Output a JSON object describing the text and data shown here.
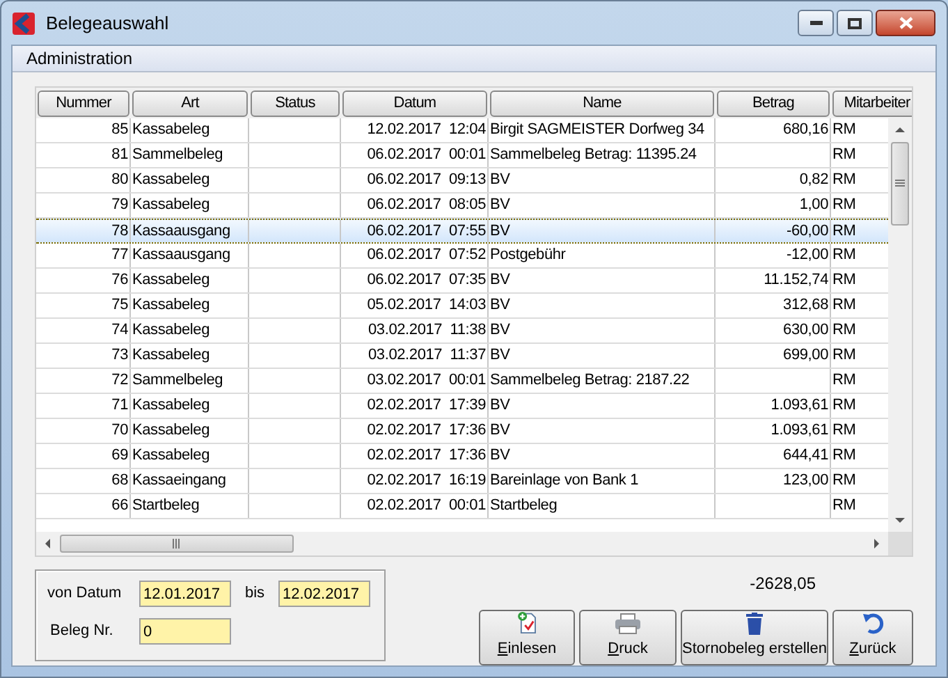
{
  "window": {
    "title": "Belegeauswahl"
  },
  "menu": [
    "Administration"
  ],
  "table": {
    "columns": [
      "Nummer",
      "Art",
      "Status",
      "Datum",
      "Name",
      "Betrag",
      "Mitarbeiter"
    ],
    "rows": [
      {
        "nummer": "85",
        "art": "Kassabeleg",
        "datum": "12.02.2017  12:04",
        "name": "Birgit SAGMEISTER  Dorfweg 34",
        "betrag": "680,16",
        "mitarbeiter": "RM",
        "selected": false
      },
      {
        "nummer": "81",
        "art": "Sammelbeleg",
        "datum": "06.02.2017  00:01",
        "name": "Sammelbeleg Betrag: 11395.24",
        "mitarbeiter": "RM",
        "selected": false
      },
      {
        "nummer": "80",
        "art": "Kassabeleg",
        "datum": "06.02.2017  09:13",
        "name": "BV",
        "betrag": "0,82",
        "mitarbeiter": "RM",
        "selected": false
      },
      {
        "nummer": "79",
        "art": "Kassabeleg",
        "datum": "06.02.2017  08:05",
        "name": "BV",
        "betrag": "1,00",
        "mitarbeiter": "RM",
        "selected": false
      },
      {
        "nummer": "78",
        "art": "Kassaausgang",
        "datum": "06.02.2017  07:55",
        "name": "BV",
        "betrag": "-60,00",
        "mitarbeiter": "RM",
        "selected": true
      },
      {
        "nummer": "77",
        "art": "Kassaausgang",
        "datum": "06.02.2017  07:52",
        "name": "Postgebühr",
        "betrag": "-12,00",
        "mitarbeiter": "RM",
        "selected": false
      },
      {
        "nummer": "76",
        "art": "Kassabeleg",
        "datum": "06.02.2017  07:35",
        "name": "BV",
        "betrag": "11.152,74",
        "mitarbeiter": "RM",
        "selected": false
      },
      {
        "nummer": "75",
        "art": "Kassabeleg",
        "datum": "05.02.2017  14:03",
        "name": "BV",
        "betrag": "312,68",
        "mitarbeiter": "RM",
        "selected": false
      },
      {
        "nummer": "74",
        "art": "Kassabeleg",
        "datum": "03.02.2017  11:38",
        "name": "BV",
        "betrag": "630,00",
        "mitarbeiter": "RM",
        "selected": false
      },
      {
        "nummer": "73",
        "art": "Kassabeleg",
        "datum": "03.02.2017  11:37",
        "name": "BV",
        "betrag": "699,00",
        "mitarbeiter": "RM",
        "selected": false
      },
      {
        "nummer": "72",
        "art": "Sammelbeleg",
        "datum": "03.02.2017  00:01",
        "name": "Sammelbeleg Betrag: 2187.22",
        "mitarbeiter": "RM",
        "selected": false
      },
      {
        "nummer": "71",
        "art": "Kassabeleg",
        "datum": "02.02.2017  17:39",
        "name": "BV",
        "betrag": "1.093,61",
        "mitarbeiter": "RM",
        "selected": false
      },
      {
        "nummer": "70",
        "art": "Kassabeleg",
        "datum": "02.02.2017  17:36",
        "name": "BV",
        "betrag": "1.093,61",
        "mitarbeiter": "RM",
        "selected": false
      },
      {
        "nummer": "69",
        "art": "Kassabeleg",
        "datum": "02.02.2017  17:36",
        "name": "BV",
        "betrag": "644,41",
        "mitarbeiter": "RM",
        "selected": false
      },
      {
        "nummer": "68",
        "art": "Kassaeingang",
        "datum": "02.02.2017  16:19",
        "name": "Bareinlage von Bank 1",
        "betrag": "123,00",
        "mitarbeiter": "RM",
        "selected": false
      },
      {
        "nummer": "66",
        "art": "Startbeleg",
        "datum": "02.02.2017  00:01",
        "name": "Startbeleg",
        "mitarbeiter": "RM",
        "selected": false
      }
    ]
  },
  "filter": {
    "von_label": "von Datum",
    "von": "12.01.2017",
    "bis_label": "bis",
    "bis": "12.02.2017",
    "beleg_label": "Beleg Nr.",
    "beleg": "0"
  },
  "total": "-2628,05",
  "buttons": [
    {
      "label": "Einlesen",
      "kind": "import",
      "underline_first": true
    },
    {
      "label": "Druck",
      "kind": "print",
      "underline_first": true
    },
    {
      "label": "Stornobeleg erstellen",
      "kind": "delete",
      "underline_first": false
    },
    {
      "label": "Zurück",
      "kind": "back",
      "underline_first": true
    }
  ]
}
